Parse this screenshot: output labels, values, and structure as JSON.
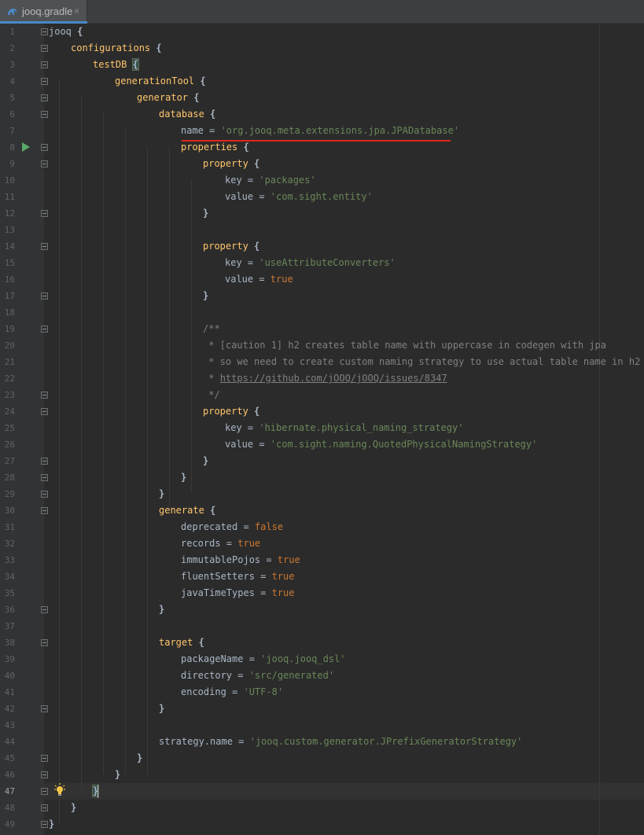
{
  "tab": {
    "filename": "jooq.gradle",
    "close_glyph": "×",
    "icon": "gradle-elephant-icon"
  },
  "active_line": 47,
  "lines": [
    {
      "n": "1",
      "t": [
        [
          "id",
          "jooq "
        ],
        [
          "brace",
          "{"
        ]
      ]
    },
    {
      "n": "2",
      "t": [
        [
          "mth",
          "configurations "
        ],
        [
          "brace",
          "{"
        ]
      ]
    },
    {
      "n": "3",
      "t": [
        [
          "mth",
          "testDB "
        ],
        [
          "brace",
          "{"
        ]
      ]
    },
    {
      "n": "4",
      "t": [
        [
          "mth",
          "generationTool "
        ],
        [
          "brace",
          "{"
        ]
      ]
    },
    {
      "n": "5",
      "t": [
        [
          "mth",
          "generator "
        ],
        [
          "brace",
          "{"
        ]
      ]
    },
    {
      "n": "6",
      "t": [
        [
          "mth",
          "database "
        ],
        [
          "brace",
          "{"
        ]
      ]
    },
    {
      "n": "7",
      "t": [
        [
          "id",
          "name = "
        ],
        [
          "str",
          "'org.jooq.meta.extensions.jpa.JPADatabase'"
        ]
      ]
    },
    {
      "n": "8",
      "t": [
        [
          "mth",
          "properties "
        ],
        [
          "brace",
          "{"
        ]
      ]
    },
    {
      "n": "9",
      "t": [
        [
          "mth",
          "property "
        ],
        [
          "brace",
          "{"
        ]
      ]
    },
    {
      "n": "10",
      "t": [
        [
          "id",
          "key = "
        ],
        [
          "str",
          "'packages'"
        ]
      ]
    },
    {
      "n": "11",
      "t": [
        [
          "id",
          "value = "
        ],
        [
          "str",
          "'com.sight.entity'"
        ]
      ]
    },
    {
      "n": "12",
      "t": [
        [
          "brace",
          "}"
        ]
      ]
    },
    {
      "n": "13",
      "t": []
    },
    {
      "n": "14",
      "t": [
        [
          "mth",
          "property "
        ],
        [
          "brace",
          "{"
        ]
      ]
    },
    {
      "n": "15",
      "t": [
        [
          "id",
          "key = "
        ],
        [
          "str",
          "'useAttributeConverters'"
        ]
      ]
    },
    {
      "n": "16",
      "t": [
        [
          "id",
          "value = "
        ],
        [
          "kw",
          "true"
        ]
      ]
    },
    {
      "n": "17",
      "t": [
        [
          "brace",
          "}"
        ]
      ]
    },
    {
      "n": "18",
      "t": []
    },
    {
      "n": "19",
      "t": [
        [
          "cmt",
          "/**"
        ]
      ]
    },
    {
      "n": "20",
      "t": [
        [
          "cmt",
          " * [caution 1] h2 creates table name with uppercase in codegen with jpa"
        ]
      ]
    },
    {
      "n": "21",
      "t": [
        [
          "cmt",
          " * so we need to create custom naming strategy to use actual table name in h2"
        ]
      ]
    },
    {
      "n": "22",
      "t": [
        [
          "cmt",
          " * "
        ],
        [
          "link",
          "https://github.com/jOOQ/jOOQ/issues/8347"
        ]
      ]
    },
    {
      "n": "23",
      "t": [
        [
          "cmt",
          " */"
        ]
      ]
    },
    {
      "n": "24",
      "t": [
        [
          "mth",
          "property "
        ],
        [
          "brace",
          "{"
        ]
      ]
    },
    {
      "n": "25",
      "t": [
        [
          "id",
          "key = "
        ],
        [
          "str",
          "'hibernate.physical_naming_strategy'"
        ]
      ]
    },
    {
      "n": "26",
      "t": [
        [
          "id",
          "value = "
        ],
        [
          "str",
          "'com.sight.naming.QuotedPhysicalNamingStrategy'"
        ]
      ]
    },
    {
      "n": "27",
      "t": [
        [
          "brace",
          "}"
        ]
      ]
    },
    {
      "n": "28",
      "t": [
        [
          "brace",
          "}"
        ]
      ]
    },
    {
      "n": "29",
      "t": [
        [
          "brace",
          "}"
        ]
      ]
    },
    {
      "n": "30",
      "t": [
        [
          "mth",
          "generate "
        ],
        [
          "brace",
          "{"
        ]
      ]
    },
    {
      "n": "31",
      "t": [
        [
          "id",
          "deprecated = "
        ],
        [
          "kw",
          "false"
        ]
      ]
    },
    {
      "n": "32",
      "t": [
        [
          "id",
          "records = "
        ],
        [
          "kw",
          "true"
        ]
      ]
    },
    {
      "n": "33",
      "t": [
        [
          "id",
          "immutablePojos = "
        ],
        [
          "kw",
          "true"
        ]
      ]
    },
    {
      "n": "34",
      "t": [
        [
          "id",
          "fluentSetters = "
        ],
        [
          "kw",
          "true"
        ]
      ]
    },
    {
      "n": "35",
      "t": [
        [
          "id",
          "javaTimeTypes = "
        ],
        [
          "kw",
          "true"
        ]
      ]
    },
    {
      "n": "36",
      "t": [
        [
          "brace",
          "}"
        ]
      ]
    },
    {
      "n": "37",
      "t": []
    },
    {
      "n": "38",
      "t": [
        [
          "mth",
          "target "
        ],
        [
          "brace",
          "{"
        ]
      ]
    },
    {
      "n": "39",
      "t": [
        [
          "id",
          "packageName = "
        ],
        [
          "str",
          "'jooq.jooq_dsl'"
        ]
      ]
    },
    {
      "n": "40",
      "t": [
        [
          "id",
          "directory = "
        ],
        [
          "str",
          "'src/generated'"
        ]
      ]
    },
    {
      "n": "41",
      "t": [
        [
          "id",
          "encoding = "
        ],
        [
          "str",
          "'UTF-8'"
        ]
      ]
    },
    {
      "n": "42",
      "t": [
        [
          "brace",
          "}"
        ]
      ]
    },
    {
      "n": "43",
      "t": []
    },
    {
      "n": "44",
      "t": [
        [
          "id",
          "strategy.name = "
        ],
        [
          "str",
          "'jooq.custom.generator.JPrefixGeneratorStrategy'"
        ]
      ]
    },
    {
      "n": "45",
      "t": [
        [
          "brace",
          "}"
        ]
      ]
    },
    {
      "n": "46",
      "t": [
        [
          "brace",
          "}"
        ]
      ]
    },
    {
      "n": "47",
      "t": [
        [
          "brace",
          "}"
        ]
      ]
    },
    {
      "n": "48",
      "t": [
        [
          "brace",
          "}"
        ]
      ]
    },
    {
      "n": "49",
      "t": [
        [
          "brace",
          "}"
        ]
      ]
    }
  ],
  "colors": {
    "background": "#2b2b2b",
    "gutter": "#313335",
    "keyword": "#cc7832",
    "string": "#6a8759",
    "method": "#ffc66d",
    "comment": "#808080",
    "error_underline": "#e0261c",
    "run_icon": "#59a869"
  }
}
